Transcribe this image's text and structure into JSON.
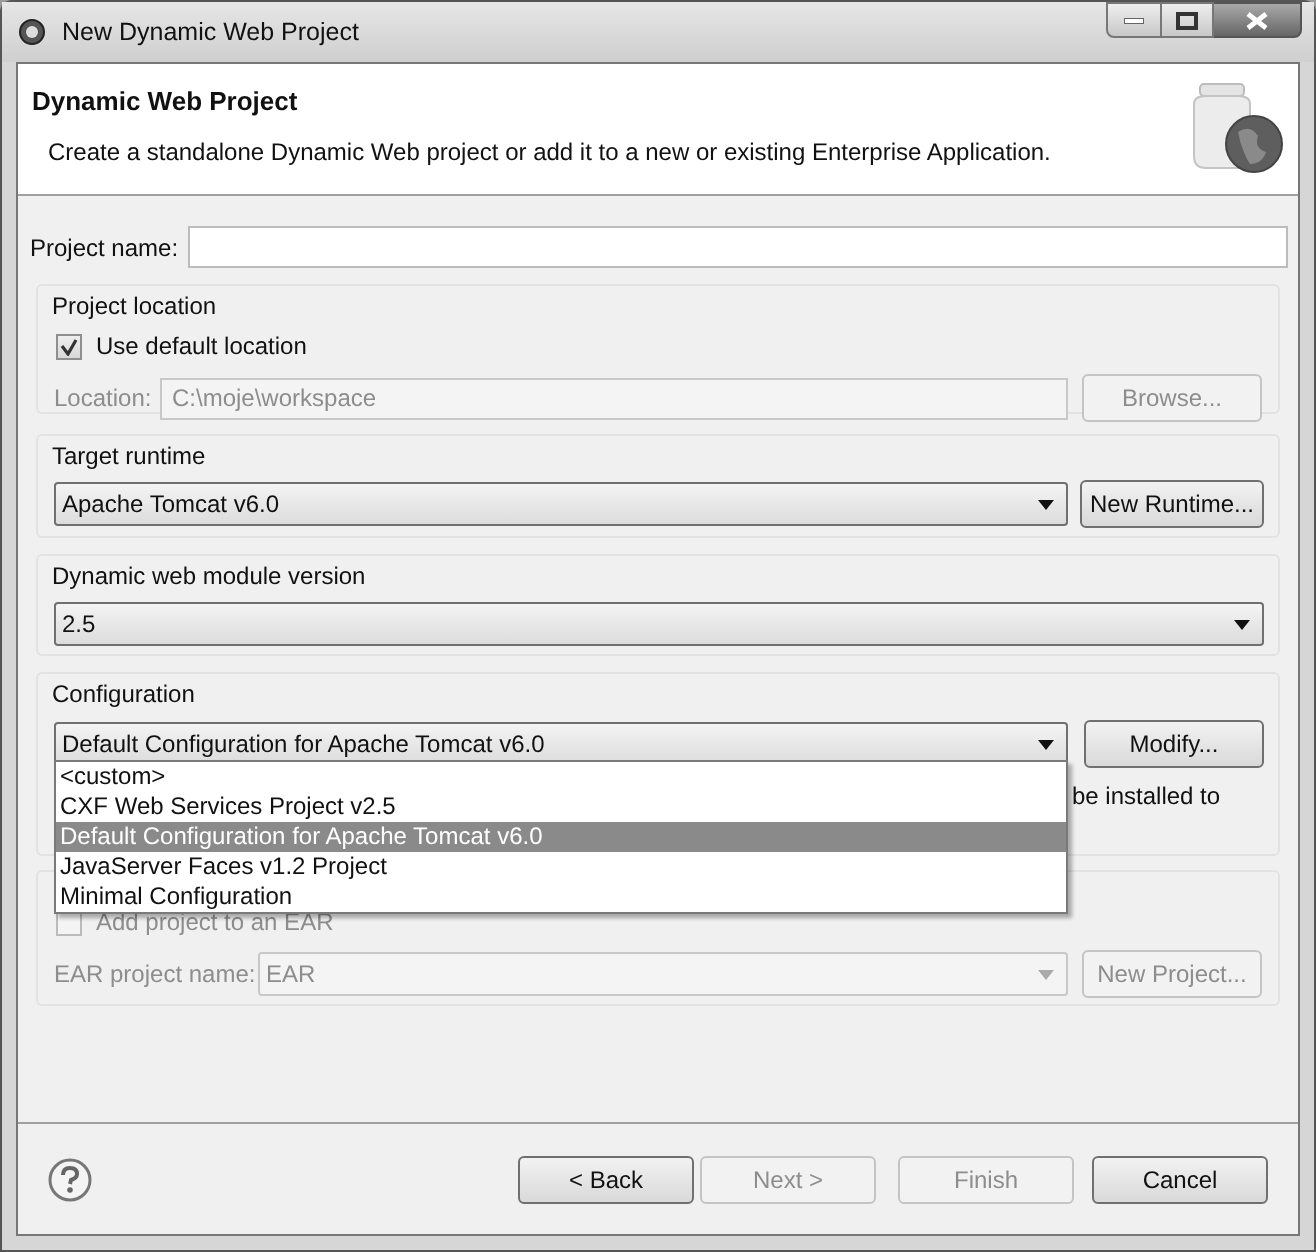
{
  "window": {
    "title": "New Dynamic Web Project"
  },
  "header": {
    "title": "Dynamic Web Project",
    "description": "Create a standalone Dynamic Web project or add it to a new or existing Enterprise Application."
  },
  "project_name": {
    "label": "Project name:"
  },
  "project_location": {
    "title": "Project location",
    "use_default": {
      "label": "Use default location",
      "checked": true
    },
    "location": {
      "label": "Location:",
      "value": "C:\\moje\\workspace",
      "disabled": true
    },
    "browse_button": {
      "label": "Browse...",
      "disabled": true
    }
  },
  "target_runtime": {
    "title": "Target runtime",
    "value": "Apache Tomcat v6.0",
    "button": "New Runtime..."
  },
  "module_version": {
    "title": "Dynamic web module version",
    "value": "2.5"
  },
  "configuration": {
    "title": "Configuration",
    "value": "Default Configuration for Apache Tomcat v6.0",
    "button": "Modify...",
    "description_fragment": "be installed to",
    "dropdown": [
      {
        "label": "<custom>",
        "selected": false
      },
      {
        "label": "CXF Web Services Project v2.5",
        "selected": false
      },
      {
        "label": "Default Configuration for Apache Tomcat v6.0",
        "selected": true
      },
      {
        "label": "JavaServer Faces v1.2 Project",
        "selected": false
      },
      {
        "label": "Minimal Configuration",
        "selected": false
      }
    ]
  },
  "ear": {
    "add_to_ear": {
      "label": "Add project to an EAR",
      "checked": false,
      "disabled": true
    },
    "project_name": {
      "label": "EAR project name:",
      "value": "EAR",
      "disabled": true
    },
    "button": {
      "label": "New Project...",
      "disabled": true
    }
  },
  "buttons": [
    {
      "label": "< Back",
      "disabled": false
    },
    {
      "label": "Next >",
      "disabled": true
    },
    {
      "label": "Finish",
      "disabled": true
    },
    {
      "label": "Cancel",
      "disabled": false
    }
  ]
}
